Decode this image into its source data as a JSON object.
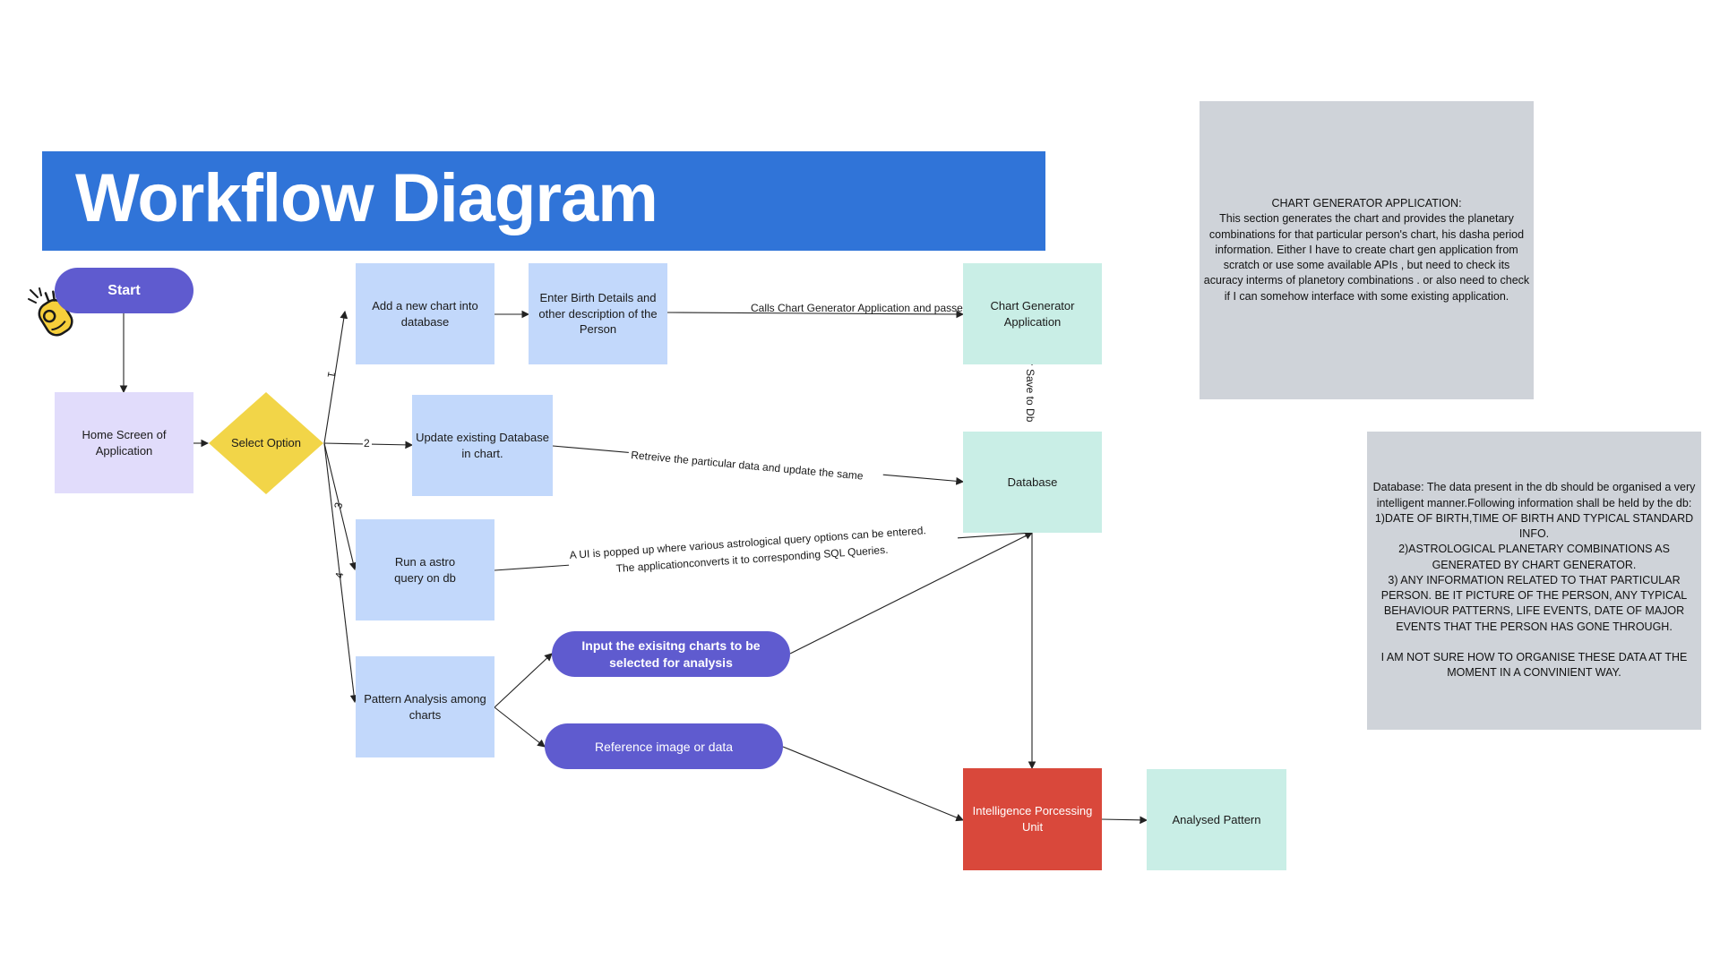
{
  "title": "Workflow Diagram",
  "nodes": {
    "start": "Start",
    "home": "Home Screen of Application",
    "select": "Select Option",
    "add_chart": "Add a new chart into database",
    "enter_birth": "Enter Birth Details and other description of the Person",
    "chart_gen": "Chart Generator Application",
    "update_db": "Update existing Database in chart.",
    "database": "Database",
    "astro_query": "Run a astro query on db",
    "pattern": "Pattern Analysis among charts",
    "input_charts": "Input the exisitng charts to be selected for analysis",
    "reference": "Reference image or data",
    "ipu": "Intelligence Porcessing Unit",
    "analysed": "Analysed Pattern"
  },
  "edges": {
    "calls_chart": "Calls Chart Generator Application and passes birth details",
    "save_db": "Save to Db",
    "retrieve": "Retreive the particular data and update the same",
    "ui_popup_1": "A UI is popped up where various astrological query options can be entered.",
    "ui_popup_2": "The applicationconverts it to corresponding SQL Queries.",
    "opt1": "1",
    "opt2": "2",
    "opt3": "3",
    "opt4": "4"
  },
  "notes": {
    "chart_generator": "CHART GENERATOR APPLICATION:\nThis section generates the chart and provides the planetary combinations for that particular person's chart, his dasha period information. Either I have to create chart gen application from scratch or use some available APIs , but need to check its acuracy interms of planetory combinations . or also need to check if I can somehow interface with some existing application.",
    "database": "Database: The data present in the db should be organised a very intelligent manner.Following information shall be held by the db:\n1)DATE OF BIRTH,TIME OF BIRTH AND TYPICAL STANDARD INFO.\n2)ASTROLOGICAL PLANETARY COMBINATIONS AS GENERATED BY CHART GENERATOR.\n3) ANY INFORMATION RELATED TO THAT PARTICULAR PERSON. BE IT PICTURE OF THE PERSON, ANY TYPICAL BEHAVIOUR PATTERNS, LIFE EVENTS, DATE OF MAJOR EVENTS THAT THE PERSON HAS GONE THROUGH.\n\nI AM NOT SURE HOW TO ORGANISE THESE DATA AT THE MOMENT IN A CONVINIENT WAY."
  },
  "colors": {
    "banner": "#3074d8",
    "pill": "#5f5bcf",
    "process": "#c2d8fb",
    "system": "#c9eee6",
    "home": "#e1dcfb",
    "decision": "#f2d548",
    "ipu": "#d9483b",
    "note": "#cfd3d9",
    "icon": "#f6cf3b"
  }
}
